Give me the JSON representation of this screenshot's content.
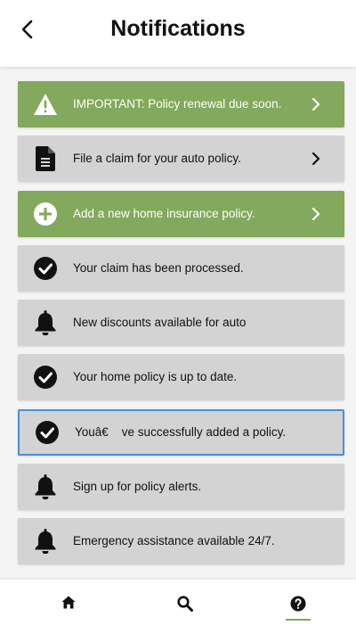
{
  "header": {
    "title": "Notifications",
    "back_icon": "chevron-left-icon"
  },
  "colors": {
    "accent_green": "#82a95c",
    "card_gray": "#d3d3d3",
    "selected_border": "#4a90d9"
  },
  "notifications": [
    {
      "label": "IMPORTANT: Policy renewal due soon.",
      "icon": "warning-icon",
      "style": "green",
      "has_chevron": true
    },
    {
      "label": "File a claim for your auto policy.",
      "icon": "document-icon",
      "style": "gray",
      "has_chevron": true
    },
    {
      "label": "Add a new home insurance policy.",
      "icon": "plus-circle-icon",
      "style": "green",
      "has_chevron": true
    },
    {
      "label": "Your claim has been processed.",
      "icon": "check-circle-icon",
      "style": "gray",
      "has_chevron": false
    },
    {
      "label": "New discounts available for auto",
      "icon": "bell-icon",
      "style": "gray",
      "has_chevron": false
    },
    {
      "label": "Your home policy is up to date.",
      "icon": "check-circle-icon",
      "style": "gray",
      "has_chevron": false
    },
    {
      "label": "Youâ€    ve successfully added a policy.",
      "icon": "check-circle-icon",
      "style": "gray",
      "has_chevron": false,
      "selected": true
    },
    {
      "label": "Sign up for policy alerts.",
      "icon": "bell-icon",
      "style": "gray",
      "has_chevron": false
    },
    {
      "label": "Emergency assistance available 24/7.",
      "icon": "bell-icon",
      "style": "gray",
      "has_chevron": false
    }
  ],
  "bottom_nav": {
    "items": [
      {
        "icon": "home-icon"
      },
      {
        "icon": "search-icon"
      },
      {
        "icon": "help-icon",
        "active": true
      }
    ]
  }
}
